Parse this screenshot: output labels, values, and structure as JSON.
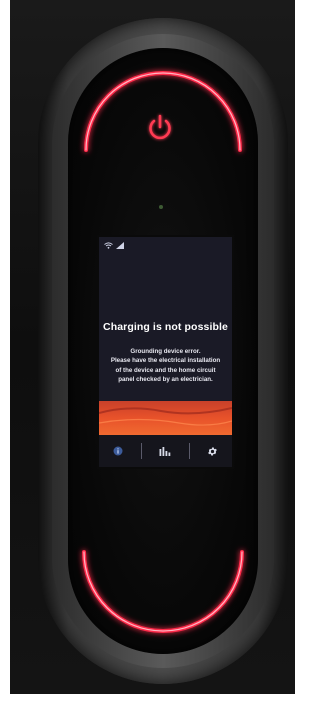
{
  "screen": {
    "title": "Charging is not possible",
    "message_lines": [
      "Grounding device error.",
      "Please have the electrical installation",
      "of the device and the home circuit",
      "panel checked by an electrician."
    ]
  },
  "nav": {
    "items": [
      {
        "icon": "info-icon"
      },
      {
        "icon": "statistics-icon"
      },
      {
        "icon": "settings-icon"
      }
    ]
  },
  "colors": {
    "led_red": "#ff2a4a",
    "led_glow": "#ff5e78",
    "screen_bg": "#1a1a26",
    "dune_orange": "#e8522a"
  }
}
